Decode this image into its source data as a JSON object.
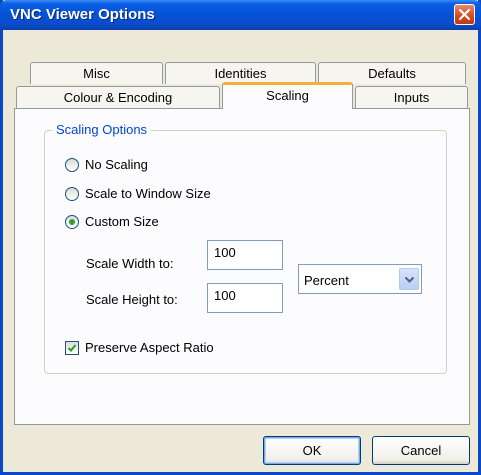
{
  "window": {
    "title": "VNC Viewer Options"
  },
  "tabs": {
    "back": [
      "Misc",
      "Identities",
      "Defaults"
    ],
    "front": [
      "Colour & Encoding",
      "Scaling",
      "Inputs"
    ],
    "active": "Scaling"
  },
  "scaling": {
    "group_title": "Scaling Options",
    "options": [
      "No Scaling",
      "Scale to Window Size",
      "Custom Size"
    ],
    "selected": "Custom Size",
    "width_label": "Scale Width to:",
    "width_value": "100",
    "height_label": "Scale Height to:",
    "height_value": "100",
    "unit_selected": "Percent",
    "preserve_label": "Preserve Aspect Ratio",
    "preserve_checked": true
  },
  "buttons": {
    "ok": "OK",
    "cancel": "Cancel"
  },
  "colors": {
    "title_bar": "#0553d8",
    "close_button": "#d8471d",
    "active_tab_highlight": "#f5b03b",
    "group_title": "#0046d5"
  },
  "icons": [
    "close-icon",
    "chevron-down-icon",
    "checkmark-icon"
  ]
}
